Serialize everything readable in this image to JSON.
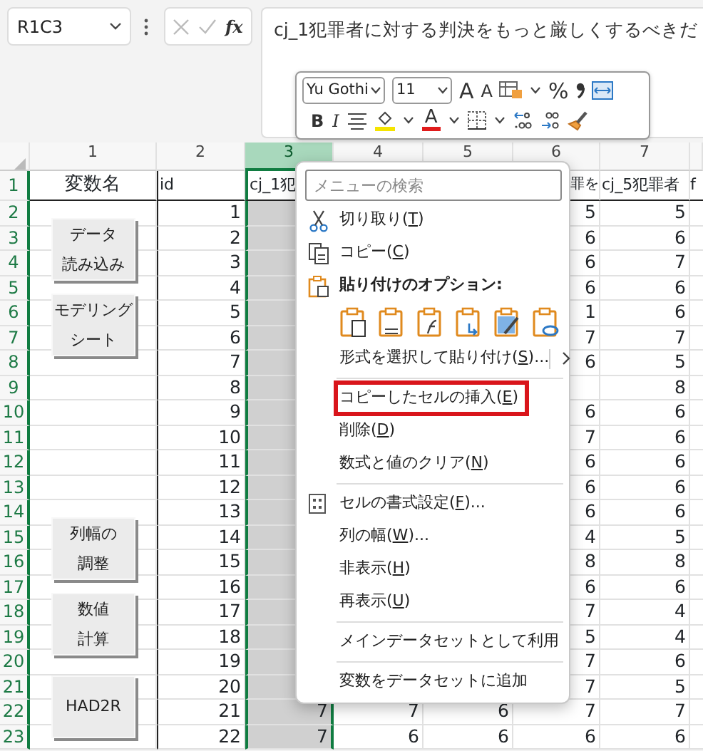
{
  "name_box": {
    "value": "R1C3"
  },
  "formula_bar": {
    "function_label": "fx",
    "value": "cj_1犯罪者に対する判決をもっと厳しくするべきだ"
  },
  "mini_toolbar": {
    "font": "Yu Gothi",
    "size": "11",
    "grow_label": "A",
    "shrink_label": "A",
    "percent_label": "%",
    "bold_label": "B",
    "italic_label": "I",
    "font_color_label": "A"
  },
  "columns": [
    {
      "label": "1",
      "selected": false
    },
    {
      "label": "2",
      "selected": false
    },
    {
      "label": "3",
      "selected": true
    },
    {
      "label": "4",
      "selected": false
    },
    {
      "label": "5",
      "selected": false
    },
    {
      "label": "6",
      "selected": false
    },
    {
      "label": "7",
      "selected": false
    }
  ],
  "rows": [
    {
      "header": "1",
      "cells": [
        "変数名",
        "id",
        "cj_1犯",
        null,
        null,
        "罪を",
        "cj_5犯罪者",
        "f"
      ]
    },
    {
      "header": "2",
      "cells": [
        null,
        "1",
        null,
        null,
        null,
        "5",
        "5",
        null
      ]
    },
    {
      "header": "3",
      "cells": [
        null,
        "2",
        null,
        null,
        null,
        "6",
        "6",
        null
      ]
    },
    {
      "header": "4",
      "cells": [
        null,
        "3",
        null,
        null,
        null,
        "6",
        "7",
        null
      ]
    },
    {
      "header": "5",
      "cells": [
        null,
        "4",
        null,
        null,
        null,
        "6",
        "6",
        null
      ]
    },
    {
      "header": "6",
      "cells": [
        null,
        "5",
        null,
        null,
        null,
        "1",
        "6",
        null
      ]
    },
    {
      "header": "7",
      "cells": [
        null,
        "6",
        null,
        null,
        null,
        "7",
        "7",
        null
      ]
    },
    {
      "header": "8",
      "cells": [
        null,
        "7",
        null,
        null,
        null,
        "6",
        "5",
        null
      ]
    },
    {
      "header": "9",
      "cells": [
        null,
        "8",
        null,
        null,
        null,
        null,
        "8",
        null
      ]
    },
    {
      "header": "10",
      "cells": [
        null,
        "9",
        null,
        null,
        null,
        "6",
        "6",
        null
      ]
    },
    {
      "header": "11",
      "cells": [
        null,
        "10",
        null,
        null,
        null,
        "7",
        "6",
        null
      ]
    },
    {
      "header": "12",
      "cells": [
        null,
        "11",
        null,
        null,
        null,
        "6",
        "6",
        null
      ]
    },
    {
      "header": "13",
      "cells": [
        null,
        "12",
        null,
        null,
        null,
        "6",
        "6",
        null
      ]
    },
    {
      "header": "14",
      "cells": [
        null,
        "13",
        null,
        null,
        null,
        "6",
        "6",
        null
      ]
    },
    {
      "header": "15",
      "cells": [
        null,
        "14",
        null,
        null,
        null,
        "4",
        "5",
        null
      ]
    },
    {
      "header": "16",
      "cells": [
        null,
        "15",
        null,
        null,
        null,
        "8",
        "8",
        null
      ]
    },
    {
      "header": "17",
      "cells": [
        null,
        "16",
        null,
        null,
        null,
        "6",
        "6",
        null
      ]
    },
    {
      "header": "18",
      "cells": [
        null,
        "17",
        null,
        null,
        null,
        "7",
        "4",
        null
      ]
    },
    {
      "header": "19",
      "cells": [
        null,
        "18",
        null,
        null,
        null,
        "5",
        "4",
        null
      ]
    },
    {
      "header": "20",
      "cells": [
        null,
        "19",
        null,
        null,
        null,
        "7",
        "6",
        null
      ]
    },
    {
      "header": "21",
      "cells": [
        null,
        "20",
        null,
        null,
        null,
        "7",
        "5",
        null
      ]
    },
    {
      "header": "22",
      "cells": [
        null,
        "21",
        "7",
        "7",
        "6",
        "7",
        "7",
        null
      ]
    },
    {
      "header": "23",
      "cells": [
        null,
        "22",
        "7",
        "6",
        "6",
        "6",
        "6",
        null
      ]
    }
  ],
  "sheet_buttons": [
    {
      "lines": [
        "データ",
        "読み込み"
      ]
    },
    {
      "lines": [
        "モデリング",
        "シート"
      ]
    },
    {
      "lines": [
        "列幅の",
        "調整"
      ]
    },
    {
      "lines": [
        "数値",
        "計算"
      ]
    },
    {
      "lines": [
        "HAD2R"
      ]
    }
  ],
  "context_menu": {
    "search": {
      "placeholder": "メニューの検索"
    },
    "items": [
      {
        "kind": "cut",
        "before": "切り取り(",
        "key": "T",
        "after": ")",
        "highlighted": false
      },
      {
        "kind": "copy",
        "before": "コピー(",
        "key": "C",
        "after": ")",
        "highlighted": false
      },
      {
        "kind": "paste_header",
        "before": "貼り付けのオプション:",
        "highlighted": false
      },
      {
        "kind": "paste_icons"
      },
      {
        "kind": "submenu",
        "before": "形式を選択して貼り付け(",
        "key": "S",
        "after": ")...",
        "highlighted": false
      },
      {
        "kind": "separator"
      },
      {
        "kind": "plain",
        "before": "コピーしたセルの挿入(",
        "key": "E",
        "after": ")",
        "highlighted": true
      },
      {
        "kind": "plain",
        "before": "削除(",
        "key": "D",
        "after": ")",
        "highlighted": false
      },
      {
        "kind": "plain",
        "before": "数式と値のクリア(",
        "key": "N",
        "after": ")",
        "highlighted": false
      },
      {
        "kind": "separator"
      },
      {
        "kind": "format",
        "before": "セルの書式設定(",
        "key": "F",
        "after": ")...",
        "highlighted": false
      },
      {
        "kind": "plain",
        "before": "列の幅(",
        "key": "W",
        "after": ")...",
        "highlighted": false
      },
      {
        "kind": "plain",
        "before": "非表示(",
        "key": "H",
        "after": ")",
        "highlighted": false
      },
      {
        "kind": "plain",
        "before": "再表示(",
        "key": "U",
        "after": ")",
        "highlighted": false
      },
      {
        "kind": "separator"
      },
      {
        "kind": "plain",
        "before": "メインデータセットとして利用",
        "highlighted": false
      },
      {
        "kind": "separator"
      },
      {
        "kind": "plain",
        "before": "変数をデータセットに追加",
        "highlighted": false
      }
    ]
  }
}
